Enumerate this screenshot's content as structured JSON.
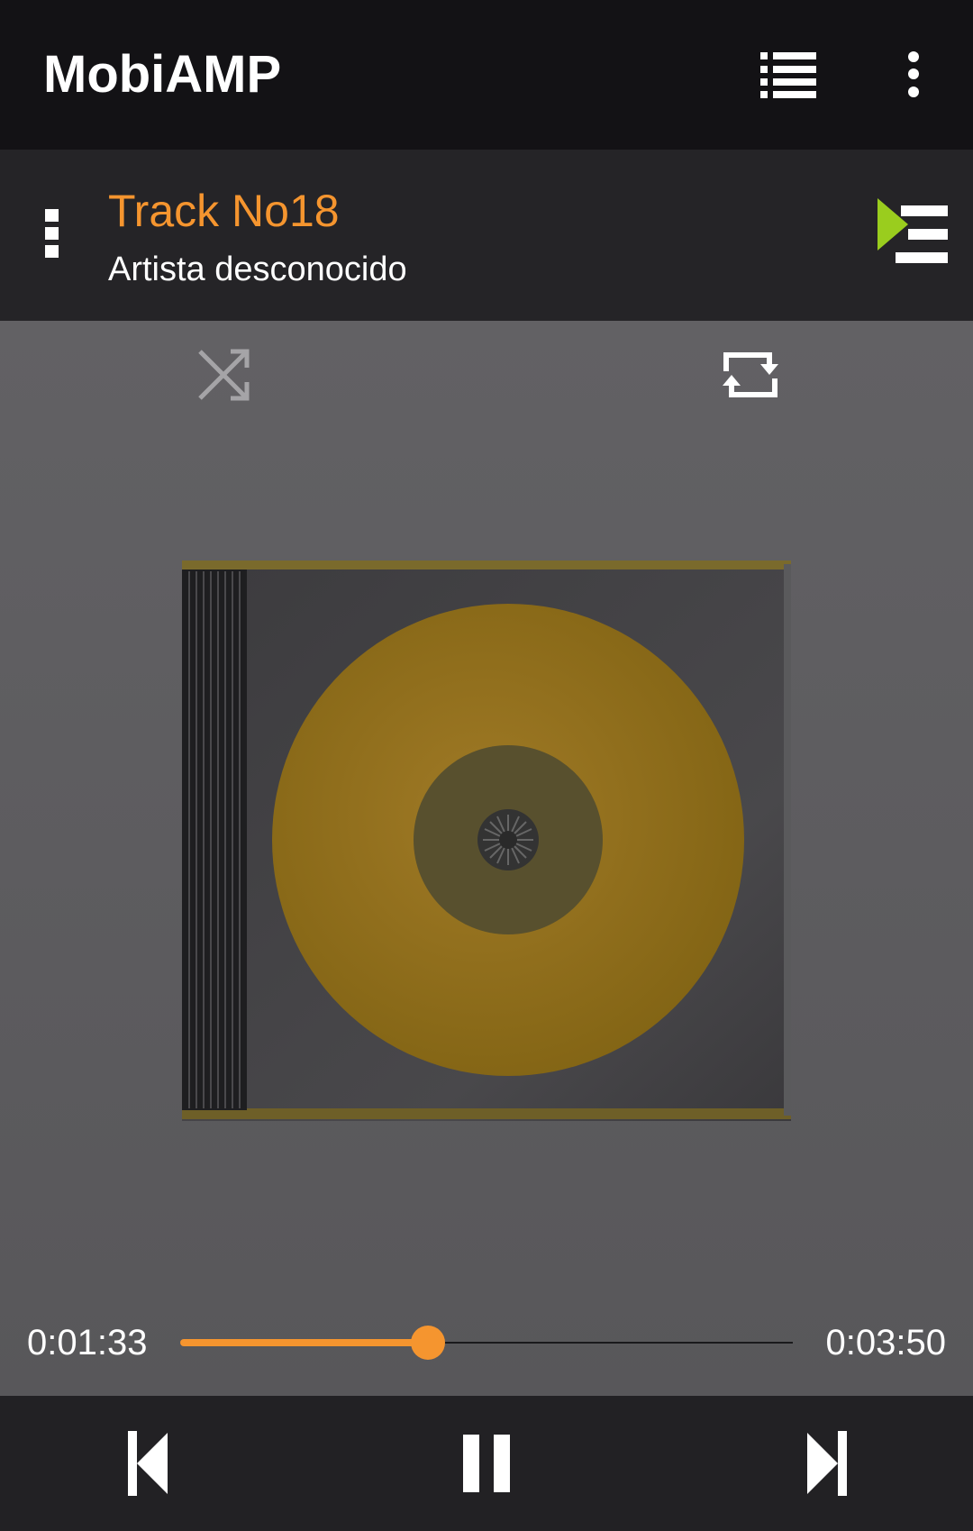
{
  "app": {
    "title": "MobiAMP"
  },
  "now_playing": {
    "title": "Track No18",
    "artist": "Artista desconocido"
  },
  "playback": {
    "elapsed": "0:01:33",
    "duration": "0:03:50",
    "progress_fraction": 0.404,
    "shuffle": false,
    "repeat": true,
    "state": "playing"
  },
  "colors": {
    "accent": "#f5952f",
    "queue_arrow": "#9acd1e",
    "appbar_bg": "#131215",
    "nowbar_bg": "#252427",
    "main_bg": "#58575a"
  },
  "icons": {
    "appbar": [
      "list-icon",
      "more-vert-icon"
    ],
    "nowbar": [
      "track-menu-icon",
      "play-queue-icon"
    ],
    "controls": [
      "shuffle-icon",
      "repeat-icon"
    ],
    "transport": [
      "previous-icon",
      "pause-icon",
      "next-icon"
    ]
  }
}
